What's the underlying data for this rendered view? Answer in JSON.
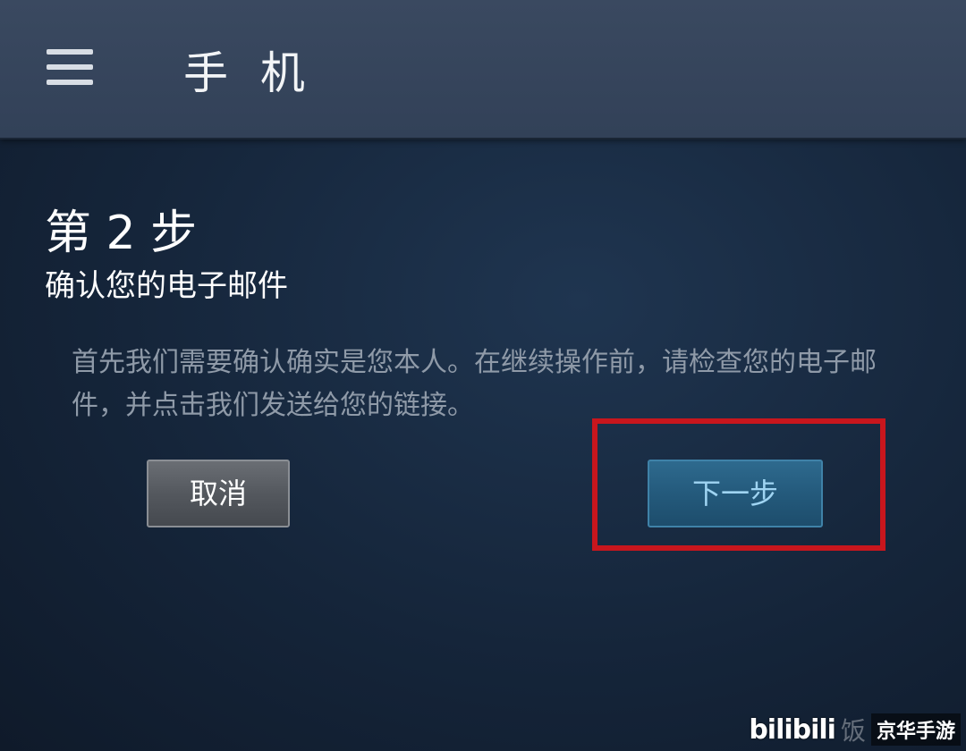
{
  "header": {
    "menu_icon": "hamburger-menu-icon",
    "title": "手 机"
  },
  "step": {
    "title": "第 2 步",
    "subtitle": "确认您的电子邮件",
    "description": "首先我们需要确认确实是您本人。在继续操作前，请检查您的电子邮件，并点击我们发送给您的链接。"
  },
  "buttons": {
    "cancel_label": "取消",
    "next_label": "下一步"
  },
  "watermark": {
    "logo": "bilibili",
    "faint": "饭",
    "brand": "京华手游"
  },
  "colors": {
    "highlight": "#c8161d",
    "next_button_text": "#9fd4f2",
    "header_bg": "#3a4960"
  }
}
